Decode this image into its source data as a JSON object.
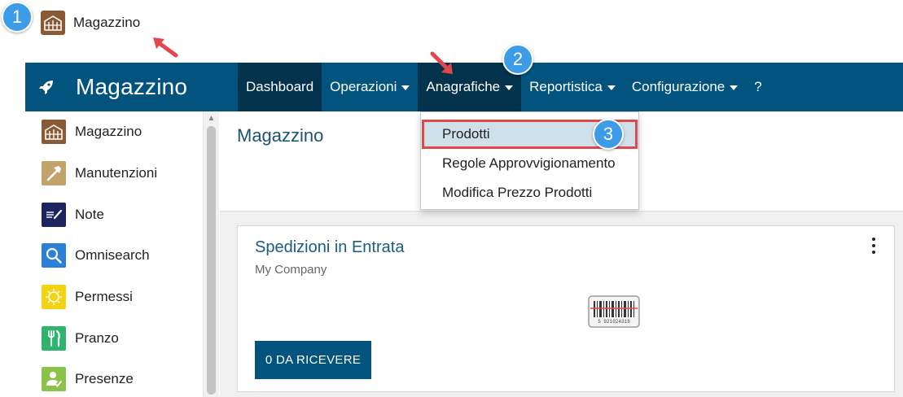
{
  "app_entry": {
    "label": "Magazzino",
    "icon": "warehouse-icon"
  },
  "steps": [
    "1",
    "2",
    "3"
  ],
  "navbar": {
    "brand": "Magazzino",
    "brand_icon": "rocket-icon",
    "items": [
      {
        "label": "Dashboard",
        "caret": false,
        "active": true
      },
      {
        "label": "Operazioni",
        "caret": true
      },
      {
        "label": "Anagrafiche",
        "caret": true,
        "active": true
      },
      {
        "label": "Reportistica",
        "caret": true
      },
      {
        "label": "Configurazione",
        "caret": true
      },
      {
        "label": "?",
        "caret": false
      }
    ]
  },
  "dropdown": {
    "items": [
      "Prodotti",
      "Regole Approvvigionamento",
      "Modifica Prezzo Prodotti"
    ],
    "highlighted": "Prodotti"
  },
  "sidebar": {
    "items": [
      {
        "label": "Magazzino",
        "icon": "warehouse-icon",
        "color": "#8a5a34"
      },
      {
        "label": "Manutenzioni",
        "icon": "hammer-icon",
        "color": "#c2a46a"
      },
      {
        "label": "Note",
        "icon": "note-pen-icon",
        "color": "#1c2560"
      },
      {
        "label": "Omnisearch",
        "icon": "search-icon",
        "color": "#2a7fd8"
      },
      {
        "label": "Permessi",
        "icon": "sun-icon",
        "color": "#f3d313"
      },
      {
        "label": "Pranzo",
        "icon": "fork-knife-icon",
        "color": "#2fb46e"
      },
      {
        "label": "Presenze",
        "icon": "user-check-icon",
        "color": "#8bc34a"
      }
    ]
  },
  "main": {
    "title": "Magazzino",
    "card": {
      "title": "Spedizioni in Entrata",
      "subtitle": "My Company",
      "barcode_icon": "barcode-icon",
      "barcode_text": "5 921024318",
      "button": "0 DA RICEVERE"
    }
  },
  "colors": {
    "navbar": "#02547e",
    "navbar_active": "#03324c",
    "badge": "#3d9ce8",
    "highlight_border": "#e2474b",
    "arrow": "#e2474b"
  }
}
